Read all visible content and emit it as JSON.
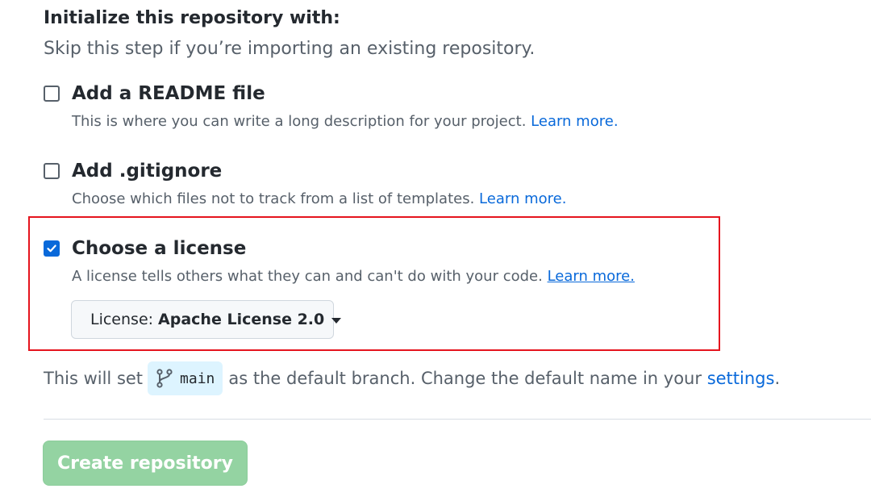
{
  "section": {
    "heading": "Initialize this repository with:",
    "subheading": "Skip this step if you’re importing an existing repository."
  },
  "options": {
    "readme": {
      "title": "Add a README file",
      "description": "This is where you can write a long description for your project.",
      "link": "Learn more.",
      "checked": false
    },
    "gitignore": {
      "title": "Add .gitignore",
      "description": "Choose which files not to track from a list of templates.",
      "link": "Learn more.",
      "checked": false
    },
    "license": {
      "title": "Choose a license",
      "description": "A license tells others what they can and can't do with your code.",
      "link": "Learn more.",
      "checked": true,
      "select_label": "License:",
      "select_value": "Apache License 2.0"
    }
  },
  "branch": {
    "prefix": "This will set",
    "name": "main",
    "suffix": "as the default branch. Change the default name in your",
    "settings_link": "settings",
    "end": "."
  },
  "actions": {
    "create_label": "Create repository"
  },
  "colors": {
    "accent": "#0969da",
    "highlight": "#e5141e",
    "button_disabled": "#94d3a2",
    "branch_pill": "#ddf4ff"
  }
}
